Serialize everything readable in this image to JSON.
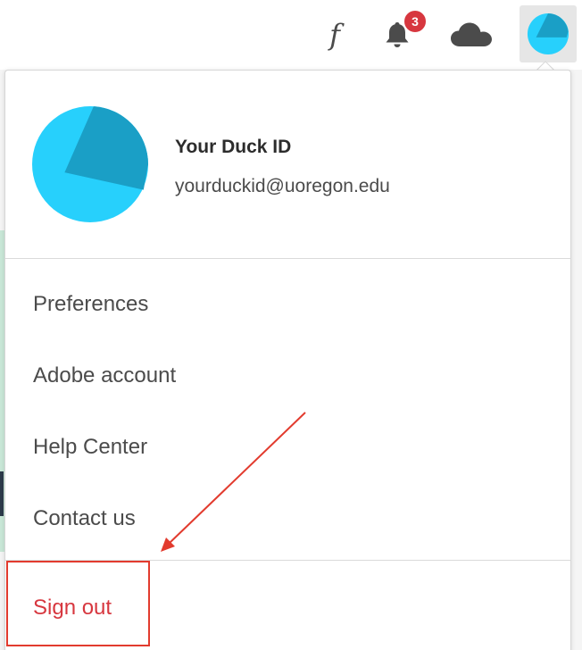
{
  "topbar": {
    "fonts_icon": "f",
    "notification_count": "3"
  },
  "profile": {
    "name": "Your Duck ID",
    "email": "yourduckid@uoregon.edu"
  },
  "menu": {
    "preferences": "Preferences",
    "adobe_account": "Adobe account",
    "help_center": "Help Center",
    "contact_us": "Contact us",
    "sign_out": "Sign out"
  },
  "colors": {
    "avatar_light": "#27d0fc",
    "avatar_dark": "#1a9fc6",
    "badge": "#d7373f",
    "sign_out": "#d7373f",
    "annotation": "#e23b2e"
  }
}
